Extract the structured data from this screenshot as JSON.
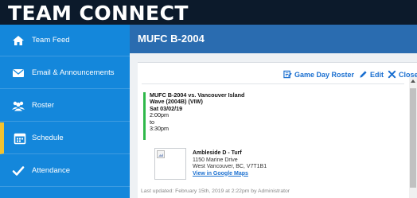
{
  "app": {
    "title": "TEAM CONNECT"
  },
  "sidebar": {
    "items": [
      {
        "label": "Team Feed",
        "icon": "home-icon"
      },
      {
        "label": "Email & Announcements",
        "icon": "envelope-icon"
      },
      {
        "label": "Roster",
        "icon": "users-icon"
      },
      {
        "label": "Schedule",
        "icon": "calendar-icon",
        "active": true
      },
      {
        "label": "Attendance",
        "icon": "check-icon"
      }
    ]
  },
  "header": {
    "title": "MUFC B-2004"
  },
  "actions": {
    "roster_label": "Game Day Roster",
    "edit_label": "Edit",
    "close_label": "Close"
  },
  "event": {
    "title_line1": "MUFC B-2004 vs. Vancouver Island",
    "title_line2": "Wave (2004B) (VIW)",
    "date": "Sat 03/02/19",
    "start_time": "2:00pm",
    "to": "to",
    "end_time": "3:30pm"
  },
  "location": {
    "name": "Ambleside D - Turf",
    "address_line1": "1150 Marine Drive",
    "address_line2": "West Vancouver, BC, V7T1B1",
    "map_link": "View in Google Maps"
  },
  "footer": {
    "last_updated": "Last updated: February 15th, 2019 at 2:22pm by Administrator"
  },
  "colors": {
    "topbar": "#0c1a2b",
    "sidebar": "#1487db",
    "header": "#2a6cb0",
    "active_indicator": "#f2c230",
    "link": "#1a6fd0",
    "event_bar": "#2fb84a"
  }
}
